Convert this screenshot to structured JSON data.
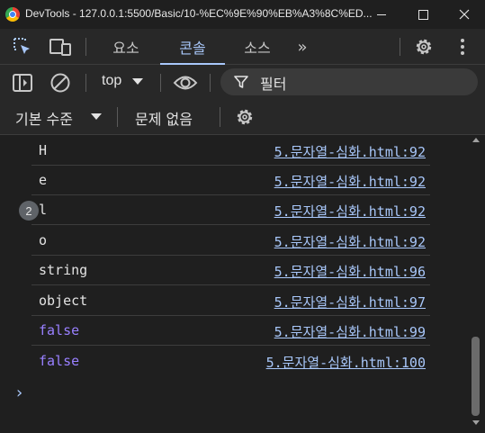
{
  "window": {
    "title": "DevTools - 127.0.0.1:5500/Basic/10-%EC%9E%90%EB%A3%8C%ED...",
    "minimize_icon": "minimize-icon",
    "maximize_icon": "maximize-icon",
    "close_icon": "close-icon"
  },
  "tabs": {
    "items": [
      {
        "label": "요소"
      },
      {
        "label": "콘솔",
        "active": true
      },
      {
        "label": "소스"
      }
    ],
    "more_label": "»",
    "inspect_icon": "inspect-element-icon",
    "device_icon": "device-toolbar-icon",
    "settings_icon": "gear-icon",
    "menu_icon": "kebab-menu-icon"
  },
  "toolbar": {
    "context_label": "top",
    "filter_placeholder": "필터",
    "levels_label": "기본 수준",
    "issues_label": "문제 없음",
    "sidebar_icon": "sidebar-toggle-icon",
    "clear_icon": "clear-console-icon",
    "eye_icon": "eye-icon",
    "filter_icon": "funnel-icon"
  },
  "console": {
    "messages": [
      {
        "text": "H",
        "type": "string",
        "source": "5.문자열-심화.html:92"
      },
      {
        "text": "e",
        "type": "string",
        "source": "5.문자열-심화.html:92"
      },
      {
        "text": "l",
        "type": "string",
        "source": "5.문자열-심화.html:92",
        "repeat": "2"
      },
      {
        "text": "o",
        "type": "string",
        "source": "5.문자열-심화.html:92"
      },
      {
        "text": "string",
        "type": "string",
        "source": "5.문자열-심화.html:96"
      },
      {
        "text": "object",
        "type": "string",
        "source": "5.문자열-심화.html:97"
      },
      {
        "text": "false",
        "type": "boolean",
        "source": "5.문자열-심화.html:99"
      },
      {
        "text": "false",
        "type": "boolean",
        "source": "5.문자열-심화.html:100"
      }
    ],
    "prompt": "›"
  },
  "colors": {
    "background": "#1f1f1f",
    "toolbar": "#282828",
    "accent": "#a8c7fa",
    "boolean": "#9980ff"
  }
}
